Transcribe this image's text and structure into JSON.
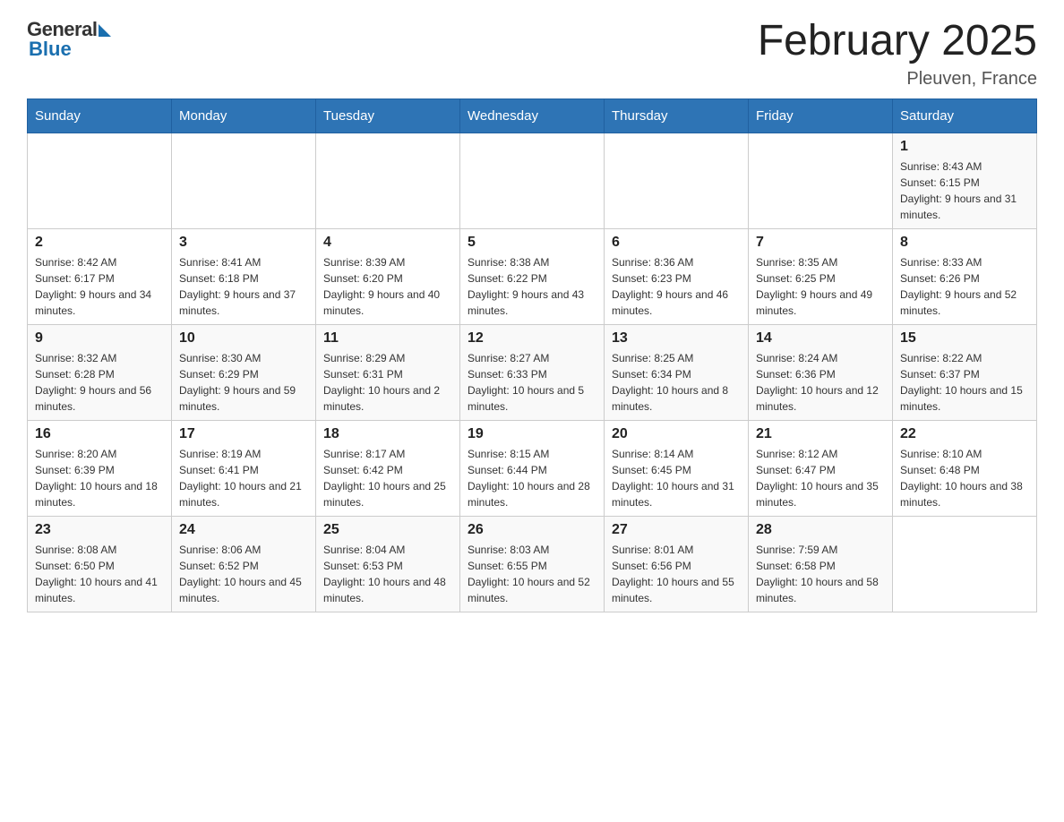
{
  "logo": {
    "general": "General",
    "blue": "Blue"
  },
  "header": {
    "title": "February 2025",
    "subtitle": "Pleuven, France"
  },
  "days_of_week": [
    "Sunday",
    "Monday",
    "Tuesday",
    "Wednesday",
    "Thursday",
    "Friday",
    "Saturday"
  ],
  "weeks": [
    [
      {
        "day": "",
        "info": ""
      },
      {
        "day": "",
        "info": ""
      },
      {
        "day": "",
        "info": ""
      },
      {
        "day": "",
        "info": ""
      },
      {
        "day": "",
        "info": ""
      },
      {
        "day": "",
        "info": ""
      },
      {
        "day": "1",
        "info": "Sunrise: 8:43 AM\nSunset: 6:15 PM\nDaylight: 9 hours and 31 minutes."
      }
    ],
    [
      {
        "day": "2",
        "info": "Sunrise: 8:42 AM\nSunset: 6:17 PM\nDaylight: 9 hours and 34 minutes."
      },
      {
        "day": "3",
        "info": "Sunrise: 8:41 AM\nSunset: 6:18 PM\nDaylight: 9 hours and 37 minutes."
      },
      {
        "day": "4",
        "info": "Sunrise: 8:39 AM\nSunset: 6:20 PM\nDaylight: 9 hours and 40 minutes."
      },
      {
        "day": "5",
        "info": "Sunrise: 8:38 AM\nSunset: 6:22 PM\nDaylight: 9 hours and 43 minutes."
      },
      {
        "day": "6",
        "info": "Sunrise: 8:36 AM\nSunset: 6:23 PM\nDaylight: 9 hours and 46 minutes."
      },
      {
        "day": "7",
        "info": "Sunrise: 8:35 AM\nSunset: 6:25 PM\nDaylight: 9 hours and 49 minutes."
      },
      {
        "day": "8",
        "info": "Sunrise: 8:33 AM\nSunset: 6:26 PM\nDaylight: 9 hours and 52 minutes."
      }
    ],
    [
      {
        "day": "9",
        "info": "Sunrise: 8:32 AM\nSunset: 6:28 PM\nDaylight: 9 hours and 56 minutes."
      },
      {
        "day": "10",
        "info": "Sunrise: 8:30 AM\nSunset: 6:29 PM\nDaylight: 9 hours and 59 minutes."
      },
      {
        "day": "11",
        "info": "Sunrise: 8:29 AM\nSunset: 6:31 PM\nDaylight: 10 hours and 2 minutes."
      },
      {
        "day": "12",
        "info": "Sunrise: 8:27 AM\nSunset: 6:33 PM\nDaylight: 10 hours and 5 minutes."
      },
      {
        "day": "13",
        "info": "Sunrise: 8:25 AM\nSunset: 6:34 PM\nDaylight: 10 hours and 8 minutes."
      },
      {
        "day": "14",
        "info": "Sunrise: 8:24 AM\nSunset: 6:36 PM\nDaylight: 10 hours and 12 minutes."
      },
      {
        "day": "15",
        "info": "Sunrise: 8:22 AM\nSunset: 6:37 PM\nDaylight: 10 hours and 15 minutes."
      }
    ],
    [
      {
        "day": "16",
        "info": "Sunrise: 8:20 AM\nSunset: 6:39 PM\nDaylight: 10 hours and 18 minutes."
      },
      {
        "day": "17",
        "info": "Sunrise: 8:19 AM\nSunset: 6:41 PM\nDaylight: 10 hours and 21 minutes."
      },
      {
        "day": "18",
        "info": "Sunrise: 8:17 AM\nSunset: 6:42 PM\nDaylight: 10 hours and 25 minutes."
      },
      {
        "day": "19",
        "info": "Sunrise: 8:15 AM\nSunset: 6:44 PM\nDaylight: 10 hours and 28 minutes."
      },
      {
        "day": "20",
        "info": "Sunrise: 8:14 AM\nSunset: 6:45 PM\nDaylight: 10 hours and 31 minutes."
      },
      {
        "day": "21",
        "info": "Sunrise: 8:12 AM\nSunset: 6:47 PM\nDaylight: 10 hours and 35 minutes."
      },
      {
        "day": "22",
        "info": "Sunrise: 8:10 AM\nSunset: 6:48 PM\nDaylight: 10 hours and 38 minutes."
      }
    ],
    [
      {
        "day": "23",
        "info": "Sunrise: 8:08 AM\nSunset: 6:50 PM\nDaylight: 10 hours and 41 minutes."
      },
      {
        "day": "24",
        "info": "Sunrise: 8:06 AM\nSunset: 6:52 PM\nDaylight: 10 hours and 45 minutes."
      },
      {
        "day": "25",
        "info": "Sunrise: 8:04 AM\nSunset: 6:53 PM\nDaylight: 10 hours and 48 minutes."
      },
      {
        "day": "26",
        "info": "Sunrise: 8:03 AM\nSunset: 6:55 PM\nDaylight: 10 hours and 52 minutes."
      },
      {
        "day": "27",
        "info": "Sunrise: 8:01 AM\nSunset: 6:56 PM\nDaylight: 10 hours and 55 minutes."
      },
      {
        "day": "28",
        "info": "Sunrise: 7:59 AM\nSunset: 6:58 PM\nDaylight: 10 hours and 58 minutes."
      },
      {
        "day": "",
        "info": ""
      }
    ]
  ]
}
